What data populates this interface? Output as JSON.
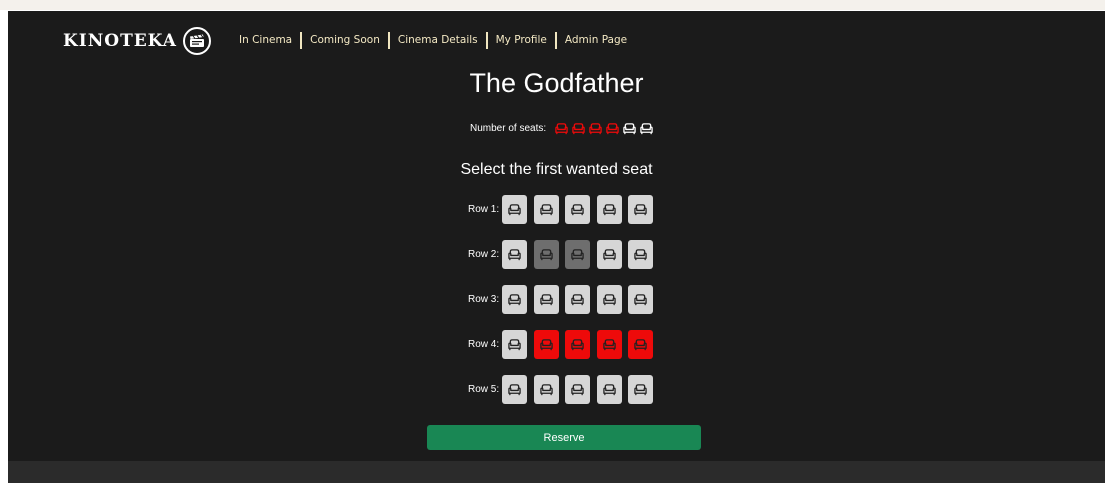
{
  "app": {
    "logo_text": "KINOTEKA",
    "logo_icon": "clapperboard-icon"
  },
  "nav": {
    "items": [
      "In Cinema",
      "Coming Soon",
      "Cinema Details",
      "My Profile",
      "Admin Page"
    ]
  },
  "movie": {
    "title": "The Godfather"
  },
  "seat_count": {
    "label": "Number of seats:",
    "selected": 4,
    "total": 6
  },
  "seat_selection": {
    "heading": "Select the first wanted seat",
    "rows": [
      {
        "label": "Row 1:",
        "seats": [
          "available",
          "available",
          "available",
          "available",
          "available"
        ]
      },
      {
        "label": "Row 2:",
        "seats": [
          "available",
          "reserved",
          "reserved",
          "available",
          "available"
        ]
      },
      {
        "label": "Row 3:",
        "seats": [
          "available",
          "available",
          "available",
          "available",
          "available"
        ]
      },
      {
        "label": "Row 4:",
        "seats": [
          "available",
          "selected",
          "selected",
          "selected",
          "selected"
        ]
      },
      {
        "label": "Row 5:",
        "seats": [
          "available",
          "available",
          "available",
          "available",
          "available"
        ]
      }
    ]
  },
  "actions": {
    "reserve_label": "Reserve"
  },
  "colors": {
    "background": "#1b1b1b",
    "nav_text": "#f4e9c4",
    "seat_available": "#d6d6d6",
    "seat_reserved": "#6e6e6e",
    "seat_selected": "#ee0a0a",
    "reserve_button": "#198754"
  }
}
